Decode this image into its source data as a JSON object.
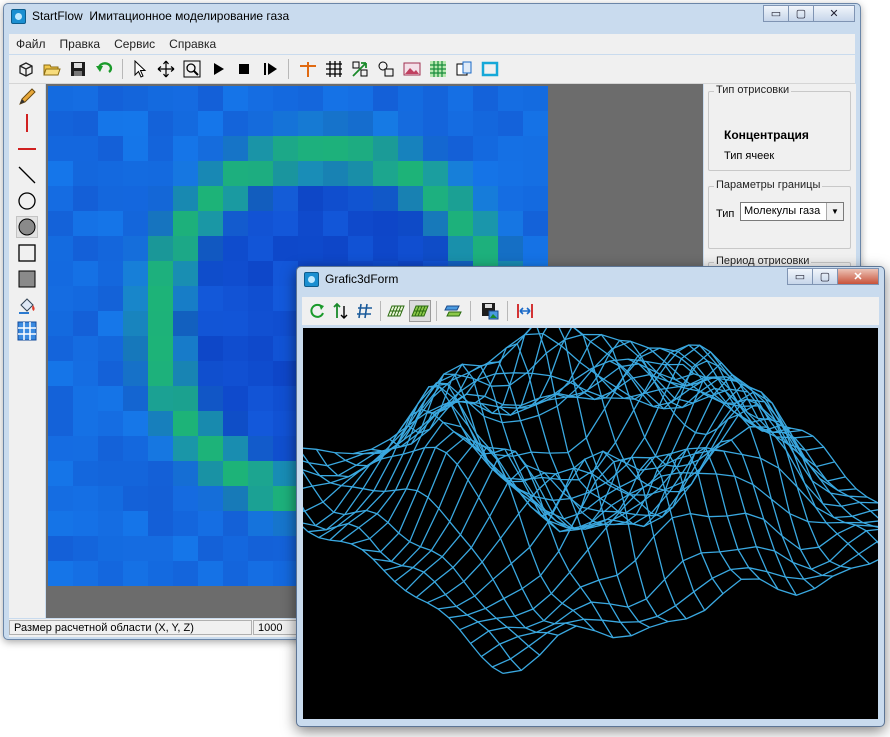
{
  "main_window": {
    "app_name": "StartFlow",
    "title_text": "Имитационное моделирование газа",
    "caption_buttons": {
      "minimize": "▭",
      "maximize": "▢",
      "close": "✕"
    }
  },
  "menu": [
    "Файл",
    "Правка",
    "Сервис",
    "Справка"
  ],
  "toolbar_icons": [
    "new-cube-icon",
    "open-folder-icon",
    "save-disk-icon",
    "undo-arrow-icon",
    "pointer-icon",
    "move-arrows-icon",
    "zoom-icon",
    "play-icon",
    "stop-icon",
    "step-forward-icon",
    "cursor-cross-icon",
    "grid-icon",
    "scale-arrow-icon",
    "shapes-icon",
    "picture-icon",
    "grid-green-icon",
    "copy-window-icon",
    "fit-frame-icon"
  ],
  "left_tools": [
    "pencil-icon",
    "vertical-line-icon",
    "horizontal-line-icon",
    "diagonal-line-icon",
    "circle-outline-icon",
    "circle-filled-icon",
    "square-outline-icon",
    "square-filled-icon",
    "paint-bucket-icon",
    "grid-cells-icon"
  ],
  "right_panel": {
    "render_type_group": {
      "title": "Тип отрисовки",
      "option_selected": "Концентрация",
      "option_other": "Тип ячеек"
    },
    "boundary_group": {
      "title": "Параметры границы",
      "type_label": "Тип",
      "type_value": "Молекулы газа"
    },
    "period_group": {
      "title": "Период отрисовки"
    }
  },
  "status": {
    "size_label": "Размер расчетной области (X, Y, Z)",
    "size_value": "1000"
  },
  "graph_window": {
    "title": "Grafic3dForm",
    "caption_buttons": {
      "minimize": "▭",
      "maximize": "▢",
      "close": "✕"
    },
    "toolbar_icons": [
      "rotate-refresh-icon",
      "axis-down-icon",
      "grid-hash-icon",
      "plane-grid-icon",
      "plane-grid-filled-icon",
      "layers-icon",
      "save-picture-icon",
      "fit-width-icon"
    ],
    "wire_color": "#3aa8e0"
  },
  "heatmap_colors": {
    "low": "#0d3fc4",
    "mid": "#1f6fe0",
    "ring": "#1fa38a",
    "ring_hi": "#22b97a"
  }
}
